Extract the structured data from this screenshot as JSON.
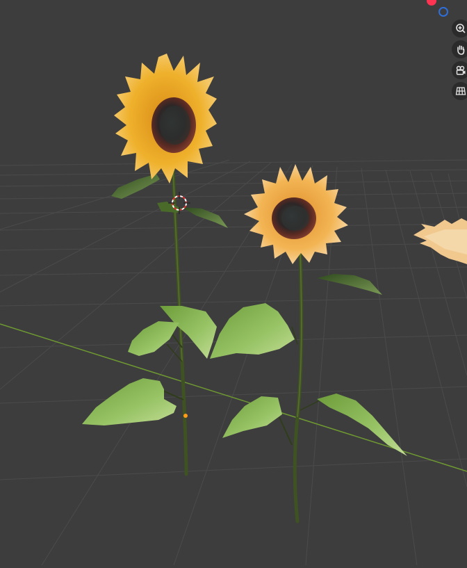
{
  "viewport": {
    "background": "#3d3d3d",
    "grid_color": "#4b4b4b",
    "x_axis_color": "#6f9a31"
  },
  "scene": {
    "objects": [
      {
        "name": "sunflower-left",
        "petal_color": "#e9a72a",
        "center_color": "#4a2c22"
      },
      {
        "name": "sunflower-right",
        "petal_color": "#f0b24a",
        "center_color": "#4d3028"
      },
      {
        "name": "sunflower-edge-partial",
        "petal_color": "#f1c98f"
      }
    ],
    "leaf_color": "#7fae4a",
    "stem_color": "#3e5222",
    "cursor": "3d-cursor",
    "origin_marker_color": "#ff9d1a"
  },
  "navigation": {
    "buttons": [
      {
        "icon": "zoom-icon",
        "tooltip": ""
      },
      {
        "icon": "hand-icon",
        "tooltip": ""
      },
      {
        "icon": "camera-icon",
        "tooltip": ""
      },
      {
        "icon": "grid-icon",
        "tooltip": ""
      }
    ],
    "gizmo_axes": [
      {
        "axis": "x",
        "color": "#ff3352"
      },
      {
        "axis": "y",
        "color": "#2f6fdb"
      }
    ]
  }
}
